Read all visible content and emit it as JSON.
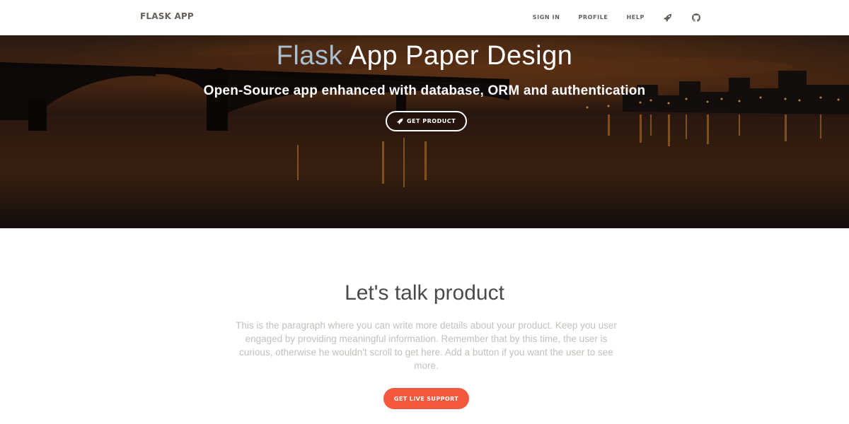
{
  "navbar": {
    "brand": "FLASK APP",
    "links": [
      "SIGN IN",
      "PROFILE",
      "HELP"
    ],
    "icons": [
      "rocket-icon",
      "github-icon"
    ]
  },
  "hero": {
    "title_accent": "Flask",
    "title_rest": " App Paper Design",
    "subtitle": "Open-Source app enhanced with database, ORM and authentication",
    "button_label": "GET PRODUCT",
    "button_icon": "rocket-icon"
  },
  "section": {
    "title": "Let's talk product",
    "paragraph": "This is the paragraph where you can write more details about your product. Keep you user engaged by providing meaningful information. Remember that by this time, the user is curious, otherwise he wouldn't scroll to get here. Add a button if you want the user to see more.",
    "button_label": "GET LIVE SUPPORT"
  },
  "colors": {
    "accent": "#f5593d",
    "title_accent": "#a8c0cf",
    "nav_text": "#66615b",
    "paragraph_text": "#c4c0bc"
  }
}
